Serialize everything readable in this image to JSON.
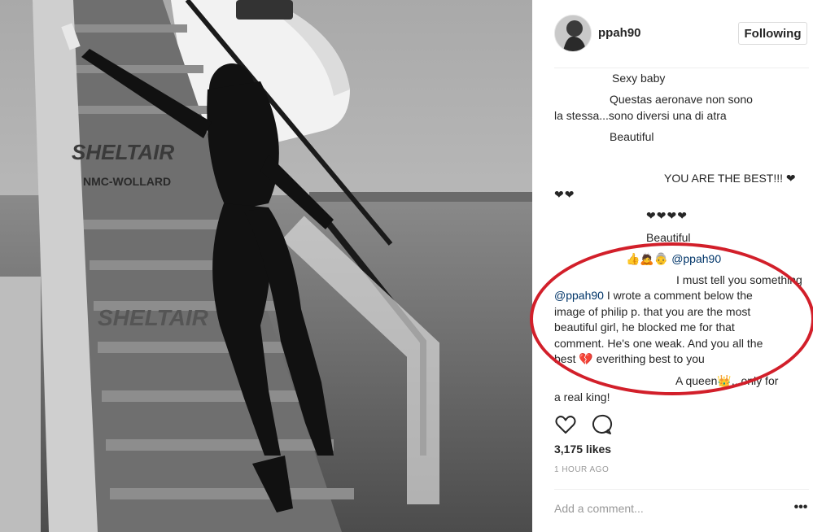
{
  "post": {
    "username": "ppah90",
    "follow_label": "Following",
    "likes": "3,175 likes",
    "time": "1 HOUR AGO",
    "add_comment_placeholder": "Add a comment...",
    "more_label": "•••",
    "photo_text": {
      "stair_brand": "SHELTAIR",
      "stair_brand_lower": "SHELTAIR",
      "stair_name": "NMC-WOLLARD"
    }
  },
  "comments": [
    {
      "text": "Sexy baby"
    },
    {
      "line1": "Questas aeronave non sono",
      "line2": "la stessa...sono diversi una di atra"
    },
    {
      "text": "Beautiful"
    },
    {
      "line1": "YOU ARE THE BEST!!! ❤",
      "line2": "❤❤"
    },
    {
      "text": "❤❤❤❤"
    },
    {
      "text": "Beautiful"
    },
    {
      "emoji": "👍🙇👵",
      "mention": "@ppah90"
    },
    {
      "line1": "I must tell you something",
      "mention": "@ppah90",
      "line2": " I wrote a comment below the",
      "line3": "image of philip p. that you are the most",
      "line4": "beautiful girl, he blocked me for that",
      "line5": "comment. He's one weak. And you all the",
      "line6a": "best ",
      "line6_emoji": "💔",
      "line6b": " everithing best to you"
    },
    {
      "line1": "A queen👑...only for",
      "line2": "a real king!"
    }
  ],
  "icons": {
    "like": "heart-icon",
    "comment": "comment-bubble-icon",
    "more": "more-options-icon"
  },
  "colors": {
    "annotation": "#d21f2a",
    "mention": "#003569",
    "meta": "#999999"
  }
}
